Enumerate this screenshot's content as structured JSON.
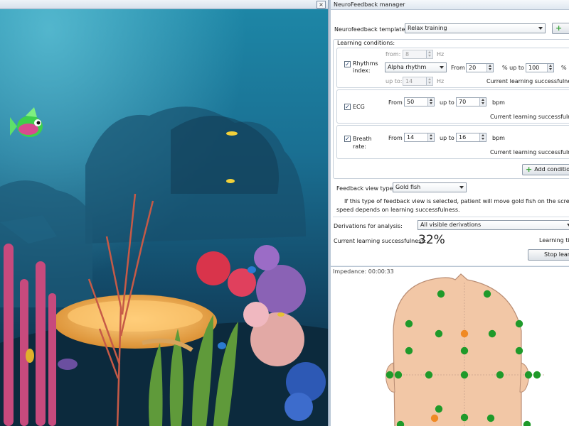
{
  "aquarium": {
    "close_glyph": "×"
  },
  "panel": {
    "title": "NeuroFeedback manager",
    "template_label": "Neurofeedback template:",
    "template_value": "Relax training",
    "add_template_symbol": "+",
    "learning_conditions_label": "Learning conditions:",
    "rhythms": {
      "label_line1": "Rhythms",
      "label_line2": "index:",
      "checked": true,
      "from_label": "from:",
      "from_value": "8",
      "from_unit": "Hz",
      "upto_label": "up to:",
      "upto_value": "14",
      "upto_unit": "Hz",
      "rhythm_value": "Alpha rhythm",
      "from2_label": "From",
      "from2_value": "20",
      "pct_upto_label": "% up to",
      "upto2_value": "100",
      "pct_unit": "%",
      "success_label": "Current learning successfulness:"
    },
    "ecg": {
      "label": "ECG",
      "checked": true,
      "from_label": "From",
      "from_value": "50",
      "upto_label": "up to",
      "upto_value": "70",
      "unit": "bpm",
      "success_label": "Current learning successfulness:"
    },
    "breath": {
      "label_line1": "Breath",
      "label_line2": "rate:",
      "checked": true,
      "from_label": "From",
      "from_value": "14",
      "upto_label": "up to",
      "upto_value": "16",
      "unit": "bpm",
      "success_label": "Current learning successfulness:"
    },
    "add_condition_label": "Add condition",
    "feedback_type_label": "Feedback view type:",
    "feedback_type_value": "Gold fish",
    "feedback_desc_line1": "If this type of feedback view is selected, patient will move gold fish on the screen. Gold fish",
    "feedback_desc_line2": "speed depends on learning successfulness.",
    "derivations_label": "Derivations for analysis:",
    "derivations_value": "All visible derivations",
    "current_success_label": "Current learning successfulness:",
    "current_success_value": "32%",
    "learning_time_label": "Learning time",
    "stop_button_label": "Stop learning"
  },
  "impedance": {
    "label": "Impedance: 00:00:33",
    "colors": {
      "good": "#1f9a2a",
      "warn": "#f08a24",
      "head": "#f2c7a6"
    },
    "electrodes": [
      {
        "status": "good"
      },
      {
        "status": "good"
      },
      {
        "status": "good"
      },
      {
        "status": "good"
      },
      {
        "status": "good"
      },
      {
        "status": "warn"
      },
      {
        "status": "good"
      },
      {
        "status": "good"
      },
      {
        "status": "good"
      },
      {
        "status": "good"
      },
      {
        "status": "good"
      },
      {
        "status": "good"
      },
      {
        "status": "good"
      },
      {
        "status": "good"
      },
      {
        "status": "good"
      },
      {
        "status": "good"
      },
      {
        "status": "good"
      },
      {
        "status": "good"
      },
      {
        "status": "warn"
      },
      {
        "status": "good"
      },
      {
        "status": "good"
      },
      {
        "status": "good"
      },
      {
        "status": "good"
      }
    ]
  }
}
